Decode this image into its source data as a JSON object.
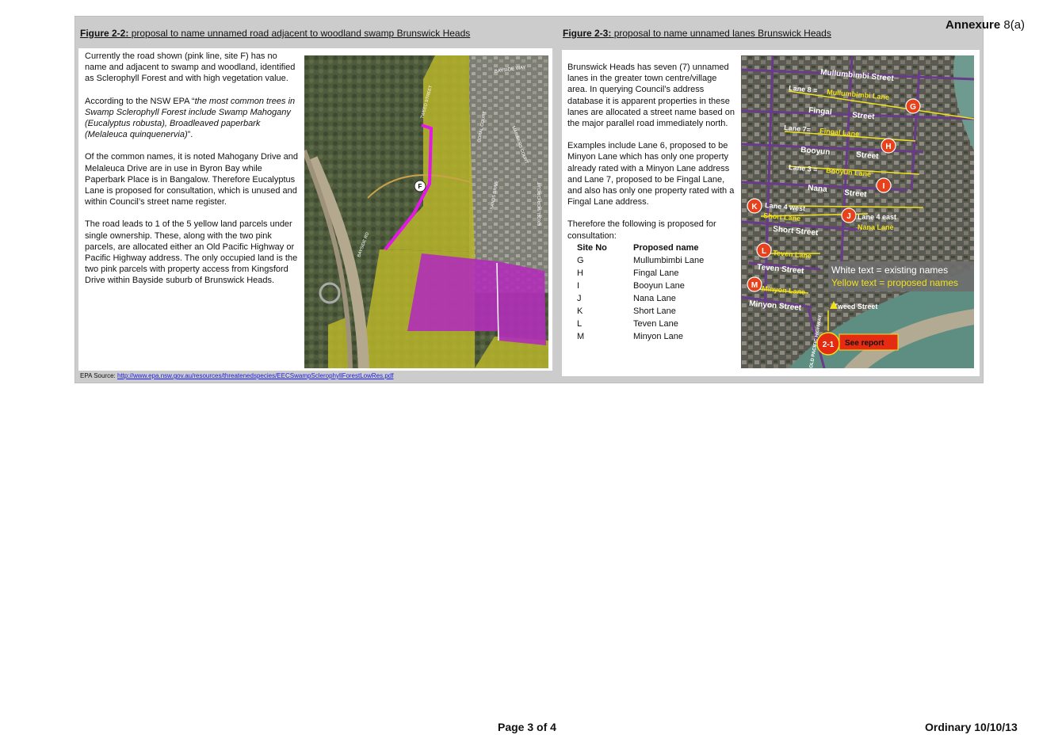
{
  "annexure": {
    "prefix": "Annexure",
    "number": "8(a)"
  },
  "figure_left": {
    "label": "Figure 2-2:",
    "title": "proposal to name unnamed road adjacent to woodland swamp Brunswick Heads",
    "paragraphs": {
      "p1": "Currently the road shown (pink line, site F) has no name and adjacent to swamp and woodland, identified as Sclerophyll Forest and with high vegetation value.",
      "p2_prefix": "According to the NSW EPA “",
      "p2_quote": "the most common trees in Swamp Sclerophyll Forest include Swamp Mahogany (Eucalyptus robusta), Broadleaved paperbark (Melaleuca quinquenervia)",
      "p2_suffix": "”.",
      "p3": "Of the common names, it is noted Mahogany Drive and Melaleuca Drive are in use in Byron Bay while Paperbark Place is in Bangalow. Therefore Eucalyptus Lane is proposed for consultation, which is unused and within Council’s street name register.",
      "p4": "The road leads to 1 of the 5 yellow land parcels under single ownership. These, along with the two pink parcels, are allocated either an Old Pacific Highway or Pacific Highway address. The only occupied land is the two pink parcels with property access from Kingsford Drive within Bayside suburb of Brunswick Heads."
    },
    "map": {
      "road_labels": {
        "bayside_way": "BAYSIDE WAY",
        "tweed_street": "TWEED STREET",
        "coral_court": "CORAL COURT",
        "mariners_court": "MARINERS COURT",
        "sands_drive": "SANDS DRIVE",
        "excelsior_circuit": "EXCELSIOR CIRCUIT",
        "bayside_rd": "BAYSIDE RD"
      },
      "site_marker": "F"
    }
  },
  "source": {
    "prefix": "EPA Source: ",
    "link": "http://www.epa.nsw.gov.au/resources/threatenedspecies/EECSwampSclerophyllForestLowRes.pdf"
  },
  "figure_right": {
    "label": "Figure 2-3:",
    "title": "proposal to name unnamed lanes Brunswick Heads",
    "paragraphs": {
      "p1": "Brunswick Heads has seven (7) unnamed lanes in the greater town centre/village area.  In querying Council’s address database it is apparent properties in these lanes are allocated a street name based on the major parallel road immediately north.",
      "p2": "Examples include Lane 6, proposed to be Minyon Lane which has only one property already rated with a Minyon Lane address and Lane 7, proposed to be Fingal Lane, and also has only one property rated with a Fingal Lane address.",
      "p3": "Therefore the following is proposed for consultation:"
    },
    "table": {
      "header_site": "Site No",
      "header_name": "Proposed name",
      "rows": [
        {
          "site": "G",
          "name": "Mullumbimbi Lane"
        },
        {
          "site": "H",
          "name": "Fingal Lane"
        },
        {
          "site": "I",
          "name": "Booyun Lane"
        },
        {
          "site": "J",
          "name": "Nana Lane"
        },
        {
          "site": "K",
          "name": "Short Lane"
        },
        {
          "site": "L",
          "name": "Teven Lane"
        },
        {
          "site": "M",
          "name": "Minyon Lane"
        }
      ]
    },
    "map": {
      "labels": {
        "mullumbimbi_street": "Mullumbimbi Street",
        "lane8_prefix": "Lane 8 = ",
        "lane8_name": "Mullumbimbi Lane",
        "fingal": "Fingal",
        "street_fingal": "Street",
        "lane7_prefix": "Lane 7= ",
        "lane7_name": "Fingal Lane",
        "booyun": "Booyun",
        "street_booyun": "Street",
        "lane3_prefix": "Lane 3 = ",
        "lane3_name": "Booyun Lane",
        "nana": "Nana",
        "street_nana": "Street",
        "lane4_west": "Lane 4 west",
        "short_lane": "Short Lane",
        "lane4_east": "Lane 4 east",
        "nana_lane": "Nana Lane",
        "short_street": "Short Street",
        "teven_lane": "Teven Lane",
        "teven_street": "Teven Street",
        "minyon_lane": "Minyon Lane",
        "minyon_street": "Minyon Street",
        "tweed_street": "Tweed Street",
        "old_pacific_highway": "OLD PACIFIC HIGHWAY",
        "legend_white": "White text = existing names",
        "legend_yellow": "Yellow text = proposed names",
        "see_report": "See report",
        "ref_marker": "2-1"
      },
      "markers": {
        "g": "G",
        "h": "H",
        "i": "I",
        "j": "J",
        "k": "K",
        "l": "L",
        "m": "M"
      },
      "colors": {
        "marker_red": "#e8421c",
        "lane_yellow": "#f2e21a",
        "road_purple": "#6a3b8a",
        "report_red": "#e52b12"
      }
    }
  },
  "footer": {
    "page": "Page 3 of 4",
    "meeting": "Ordinary 10/10/13"
  }
}
